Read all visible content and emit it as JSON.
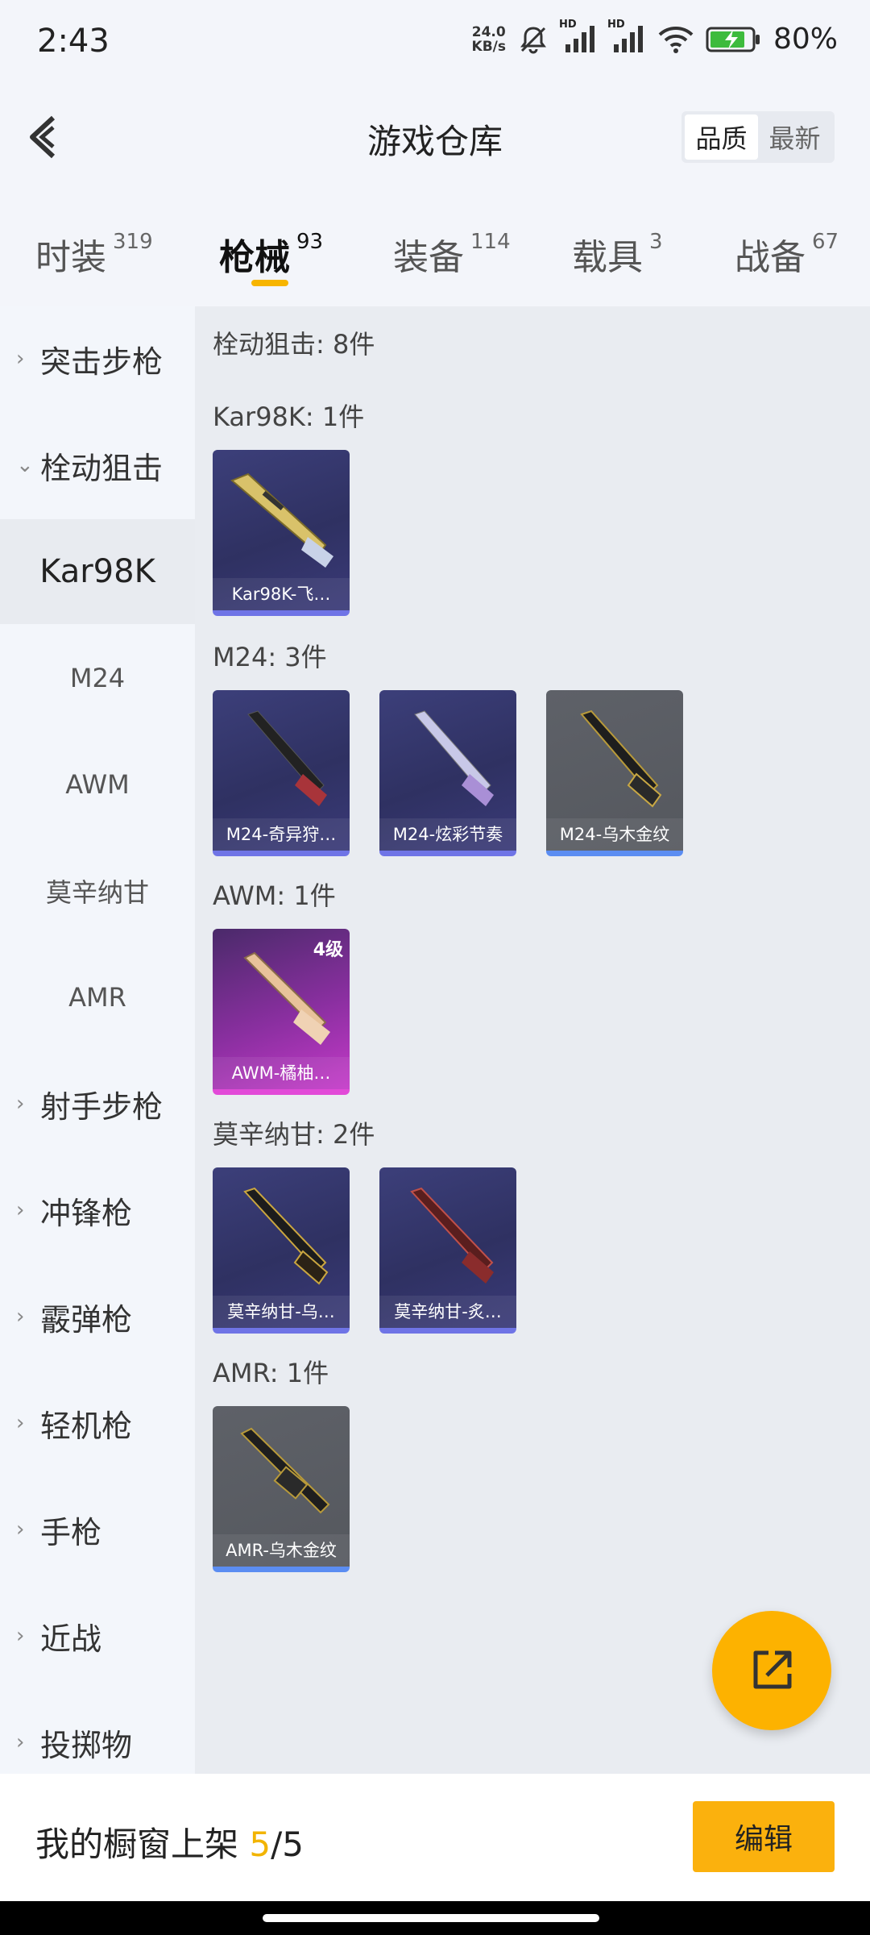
{
  "status": {
    "time": "2:43",
    "net_speed_top": "24.0",
    "net_speed_bottom": "KB/s",
    "battery": "80%",
    "hd1": "HD",
    "hd2": "HD"
  },
  "header": {
    "title": "游戏仓库",
    "sort": [
      "品质",
      "最新"
    ],
    "sort_active": "品质"
  },
  "tabs": [
    {
      "label": "时装",
      "count": "319"
    },
    {
      "label": "枪械",
      "count": "93"
    },
    {
      "label": "装备",
      "count": "114"
    },
    {
      "label": "载具",
      "count": "3"
    },
    {
      "label": "战备",
      "count": "67"
    }
  ],
  "active_tab": "枪械",
  "sidebar": {
    "items": [
      {
        "label": "突击步枪",
        "kind": "category",
        "expanded": false
      },
      {
        "label": "栓动狙击",
        "kind": "category",
        "expanded": true
      },
      {
        "label": "Kar98K",
        "kind": "sub",
        "selected": true
      },
      {
        "label": "M24",
        "kind": "sub"
      },
      {
        "label": "AWM",
        "kind": "sub"
      },
      {
        "label": "莫辛纳甘",
        "kind": "sub"
      },
      {
        "label": "AMR",
        "kind": "sub"
      },
      {
        "label": "射手步枪",
        "kind": "category",
        "expanded": false
      },
      {
        "label": "冲锋枪",
        "kind": "category",
        "expanded": false
      },
      {
        "label": "霰弹枪",
        "kind": "category",
        "expanded": false
      },
      {
        "label": "轻机枪",
        "kind": "category",
        "expanded": false
      },
      {
        "label": "手枪",
        "kind": "category",
        "expanded": false
      },
      {
        "label": "近战",
        "kind": "category",
        "expanded": false
      },
      {
        "label": "投掷物",
        "kind": "category",
        "expanded": false
      }
    ]
  },
  "content": {
    "summary": "栓动狙击: 8件",
    "sections": [
      {
        "title": "Kar98K: 1件",
        "items": [
          {
            "name": "Kar98K-飞…",
            "rarity": "blue"
          }
        ]
      },
      {
        "title": "M24: 3件",
        "items": [
          {
            "name": "M24-奇异狩…",
            "rarity": "blue"
          },
          {
            "name": "M24-炫彩节奏",
            "rarity": "blue"
          },
          {
            "name": "M24-乌木金纹",
            "rarity": "gray"
          }
        ]
      },
      {
        "title": "AWM: 1件",
        "items": [
          {
            "name": "AWM-橘柚…",
            "rarity": "pink",
            "level": "4级"
          }
        ]
      },
      {
        "title": "莫辛纳甘: 2件",
        "items": [
          {
            "name": "莫辛纳甘-乌…",
            "rarity": "blue"
          },
          {
            "name": "莫辛纳甘-炙…",
            "rarity": "blue"
          }
        ]
      },
      {
        "title": "AMR: 1件",
        "items": [
          {
            "name": "AMR-乌木金纹",
            "rarity": "gray"
          }
        ]
      }
    ]
  },
  "fab": {
    "icon": "share-external-icon"
  },
  "bottom": {
    "shelf_label": "我的橱窗上架",
    "shelf_current": "5",
    "shelf_total": "/5",
    "edit_label": "编辑"
  },
  "colors": {
    "accent": "#f7b500",
    "rarity_blue": "#6f74e6",
    "rarity_gray": "#5b8df2",
    "rarity_pink": "#e24ad8"
  }
}
